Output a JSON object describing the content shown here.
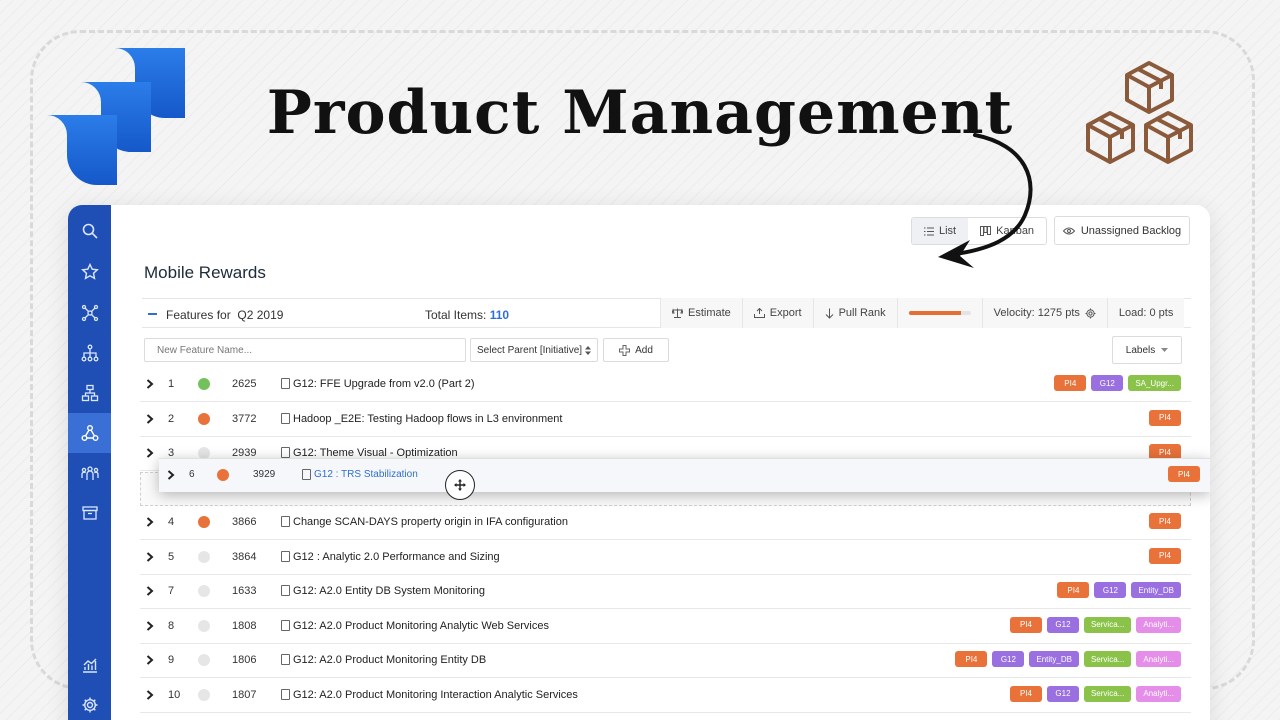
{
  "headline": "Product Management",
  "header": {
    "view_list": "List",
    "view_kanban": "Kanban",
    "backlog_button": "Unassigned Backlog"
  },
  "page_title": "Mobile Rewards",
  "toolbar": {
    "features_label": "Features for",
    "features_quarter": "Q2 2019",
    "total_label": "Total Items:",
    "total_value": "110",
    "estimate": "Estimate",
    "export": "Export",
    "pull_rank": "Pull Rank",
    "progress_fraction": 0.85,
    "velocity": "Velocity: 1275 pts",
    "load": "Load: 0 pts"
  },
  "form": {
    "new_feature_placeholder": "New Feature Name...",
    "select_parent": "Select Parent [Initiative]",
    "add_label": "Add",
    "labels_button": "Labels"
  },
  "colors": {
    "sidebar": "#1f4fb5",
    "accent": "#2f6fd1",
    "dot_green": "#74c15b",
    "dot_orange": "#e8723a",
    "dot_gray": "#e6e6e6",
    "tag_pi4": "#e8723a",
    "tag_g12": "#9a6fe0",
    "tag_green": "#8bc34a",
    "tag_pink": "#e58ee9"
  },
  "tag_colors": {
    "PI4": "#e8723a",
    "G12": "#9a6fe0",
    "SA_Upgr...": "#8bc34a",
    "Entity_DB": "#9a6fe0",
    "Servica...": "#8bc34a",
    "Analyti...": "#e58ee9"
  },
  "sidebar_icons": [
    "search-icon",
    "star-icon",
    "network-icon",
    "hierarchy-icon",
    "org-chart-icon",
    "nodes-icon",
    "people-icon",
    "archive-icon",
    "analytics-icon",
    "settings-icon"
  ],
  "rows": [
    {
      "rank": "1",
      "status": "green",
      "id": "2625",
      "title": "G12: FFE Upgrade from v2.0 (Part 2)",
      "tags": [
        "PI4",
        "G12",
        "SA_Upgr..."
      ]
    },
    {
      "rank": "2",
      "status": "orange",
      "id": "3772",
      "title": "Hadoop _E2E: Testing Hadoop flows in L3 environment",
      "tags": [
        "PI4"
      ]
    },
    {
      "rank": "3",
      "status": "gray",
      "id": "2939",
      "title": "G12: Theme Visual - Optimization",
      "tags": [
        "PI4"
      ]
    },
    {
      "rank": "",
      "status": "none",
      "id": "",
      "title": "",
      "tags": [],
      "placeholder": true
    },
    {
      "rank": "4",
      "status": "orange",
      "id": "3866",
      "title": "Change SCAN-DAYS property origin in IFA configuration",
      "tags": [
        "PI4"
      ]
    },
    {
      "rank": "5",
      "status": "gray",
      "id": "3864",
      "title": "G12 : Analytic 2.0 Performance and Sizing",
      "tags": [
        "PI4"
      ]
    },
    {
      "rank": "7",
      "status": "gray",
      "id": "1633",
      "title": "G12: A2.0 Entity DB System Monitoring",
      "tags": [
        "PI4",
        "G12",
        "Entity_DB"
      ]
    },
    {
      "rank": "8",
      "status": "gray",
      "id": "1808",
      "title": "G12: A2.0 Product Monitoring Analytic Web Services",
      "tags": [
        "PI4",
        "G12",
        "Servica...",
        "Analyti..."
      ]
    },
    {
      "rank": "9",
      "status": "gray",
      "id": "1806",
      "title": "G12: A2.0 Product Monitoring Entity DB",
      "tags": [
        "PI4",
        "G12",
        "Entity_DB",
        "Servica...",
        "Analyti..."
      ]
    },
    {
      "rank": "10",
      "status": "gray",
      "id": "1807",
      "title": "G12: A2.0 Product Monitoring Interaction Analytic Services",
      "tags": [
        "PI4",
        "G12",
        "Servica...",
        "Analyti..."
      ]
    }
  ],
  "dragging_row": {
    "rank": "6",
    "status": "orange",
    "id": "3929",
    "title": "G12 : TRS Stabilization",
    "tags": [
      "PI4"
    ]
  }
}
